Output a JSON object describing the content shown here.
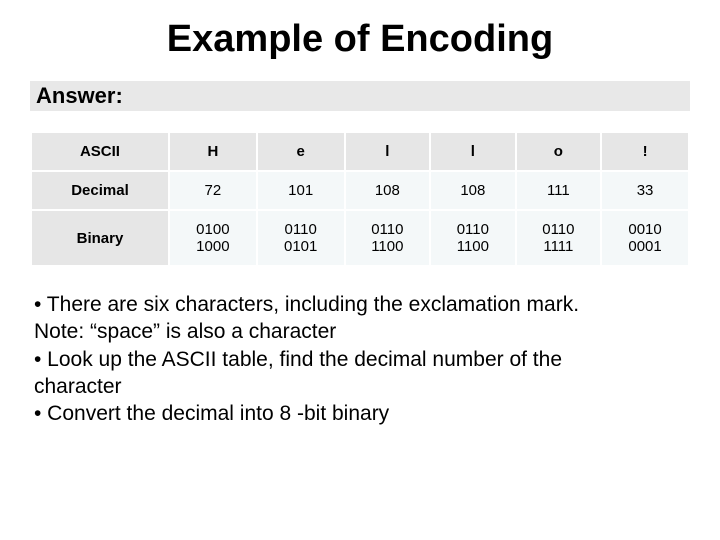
{
  "title": "Example of Encoding",
  "answer_label": "Answer:",
  "table": {
    "headers": [
      "ASCII",
      "H",
      "e",
      "l",
      "l",
      "o",
      "!"
    ],
    "rows": [
      {
        "label": "Decimal",
        "cells": [
          "72",
          "101",
          "108",
          "108",
          "111",
          "33"
        ]
      },
      {
        "label": "Binary",
        "cells": [
          "0100\n1000",
          "0110\n0101",
          "0110\n1100",
          "0110\n1100",
          "0110\n1111",
          "0010\n0001"
        ]
      }
    ]
  },
  "bullets": [
    "• There are six characters, including the exclamation mark.",
    "Note: “space” is also a character",
    "• Look up the ASCII table, find the decimal number of the",
    "character",
    "• Convert the decimal into 8 -bit binary"
  ]
}
